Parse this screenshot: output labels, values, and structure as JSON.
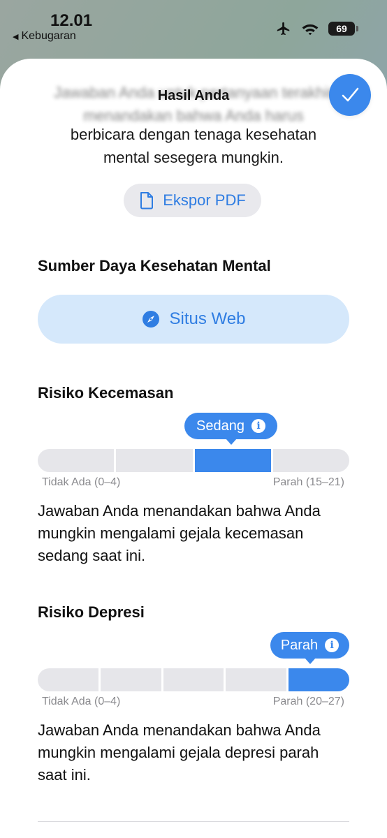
{
  "status_bar": {
    "time": "12.01",
    "back_label": "Kebugaran",
    "battery": "69"
  },
  "sheet": {
    "title": "Hasil Anda",
    "blurred_line_1": "Jawaban Anda untuk pertanyaan terakhir",
    "blurred_line_2": "menandakan bahwa Anda harus",
    "intro_line_1": "berbicara dengan tenaga kesehatan",
    "intro_line_2": "mental sesegera mungkin.",
    "export_label": "Ekspor PDF"
  },
  "resources": {
    "title": "Sumber Daya Kesehatan Mental",
    "website_label": "Situs Web"
  },
  "anxiety": {
    "title": "Risiko Kecemasan",
    "level": "Sedang",
    "segments": 4,
    "active_segment": 3,
    "min_label": "Tidak Ada (0–4)",
    "max_label": "Parah (15–21)",
    "description_line_1": "Jawaban Anda menandakan bahwa Anda",
    "description_line_2": "mungkin mengalami gejala kecemasan",
    "description_line_3": "sedang saat ini."
  },
  "depression": {
    "title": "Risiko Depresi",
    "level": "Parah",
    "segments": 5,
    "active_segment": 5,
    "min_label": "Tidak Ada (0–4)",
    "max_label": "Parah (20–27)",
    "description_line_1": "Jawaban Anda menandakan bahwa Anda",
    "description_line_2": "mungkin mengalami gejala depresi parah",
    "description_line_3": "saat ini."
  },
  "icons": {
    "back": "back-triangle-icon",
    "airplane": "airplane-icon",
    "wifi": "wifi-icon",
    "done": "checkmark-icon",
    "export": "document-icon",
    "website": "compass-icon",
    "info": "info-icon"
  },
  "colors": {
    "accent": "#3b88ec",
    "link": "#2f7de2",
    "website_bg": "#d5e8fb",
    "segment_bg": "#e6e6ea"
  }
}
